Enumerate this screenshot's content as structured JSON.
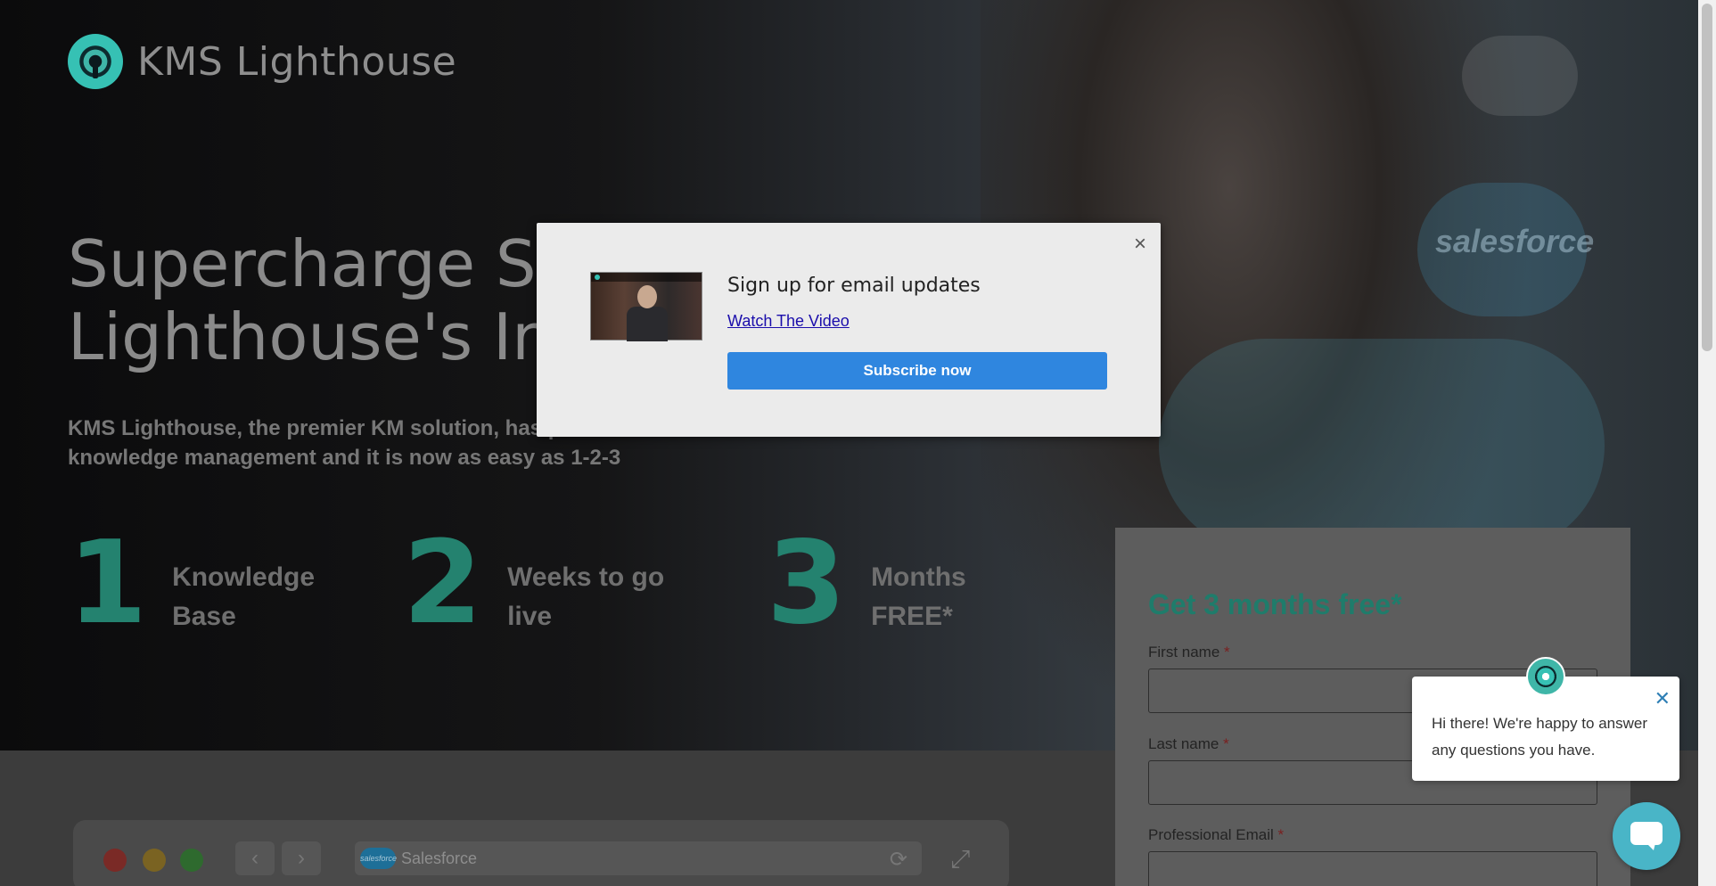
{
  "brand": {
    "name": "KMS Lighthouse"
  },
  "hero": {
    "headline_line1": "Supercharge Sa",
    "headline_line2": "Lighthouse's Int",
    "subtext_line1": "KMS Lighthouse, the premier KM solution, has pa",
    "subtext_line2": "knowledge management and it is now as easy as 1-2-3",
    "background_watermark": "salesforce",
    "steps": [
      {
        "number": "1",
        "label_line1": "Knowledge",
        "label_line2": "Base"
      },
      {
        "number": "2",
        "label_line1": "Weeks to go",
        "label_line2": "live"
      },
      {
        "number": "3",
        "label_line1": "Months",
        "label_line2": "FREE*"
      }
    ]
  },
  "browser_mock": {
    "url_text": "Salesforce",
    "badge_text": "salesforce",
    "back_icon": "chevron-left-icon",
    "forward_icon": "chevron-right-icon",
    "refresh_icon": "refresh-icon",
    "expand_icon": "expand-icon",
    "dot_colors": [
      "#7a2a26",
      "#7a6322",
      "#2e6a2e"
    ]
  },
  "form": {
    "title": "Get 3 months free*",
    "fields": [
      {
        "label": "First name",
        "required_mark": "*"
      },
      {
        "label": "Last name",
        "required_mark": "*"
      },
      {
        "label": "Professional Email",
        "required_mark": "*"
      }
    ]
  },
  "modal": {
    "close_glyph": "×",
    "title": "Sign up for email updates",
    "link_text": "Watch The Video",
    "button_label": "Subscribe now"
  },
  "chat": {
    "close_glyph": "✕",
    "message": "Hi there! We're happy to answer any questions you have."
  },
  "colors": {
    "accent_teal": "#36c1b4",
    "button_blue": "#2f86df",
    "form_title_green": "#1f7c6b",
    "chat_button": "#49b5c7"
  }
}
